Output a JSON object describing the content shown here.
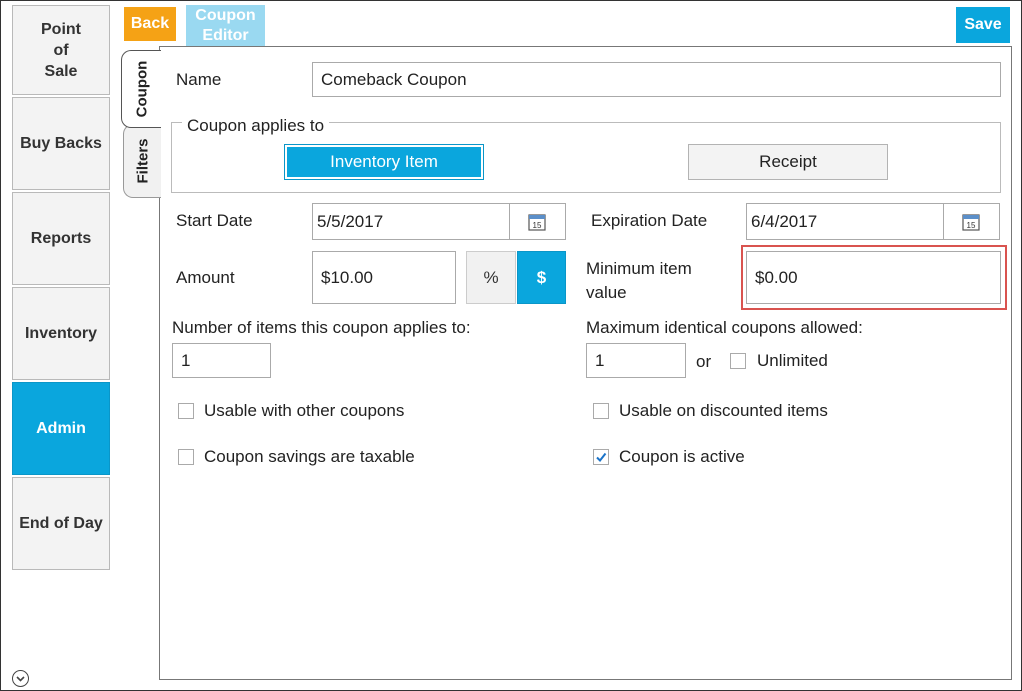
{
  "sidebar": {
    "items": [
      {
        "label": "Point\nof\nSale"
      },
      {
        "label": "Buy Backs"
      },
      {
        "label": "Reports"
      },
      {
        "label": "Inventory"
      },
      {
        "label": "Admin"
      },
      {
        "label": "End of Day"
      }
    ],
    "active": "Admin"
  },
  "toolbar": {
    "back_label": "Back",
    "title_label": "Coupon Editor",
    "save_label": "Save"
  },
  "tabs": [
    {
      "label": "Coupon",
      "active": true
    },
    {
      "label": "Filters",
      "active": false
    }
  ],
  "form": {
    "name_label": "Name",
    "name_value": "Comeback Coupon",
    "applies_to_legend": "Coupon applies to",
    "applies_options": [
      "Inventory Item",
      "Receipt"
    ],
    "applies_selected": "Inventory Item",
    "start_date_label": "Start Date",
    "start_date_value": "5/5/2017",
    "expiration_date_label": "Expiration Date",
    "expiration_date_value": "6/4/2017",
    "calendar_day": "15",
    "amount_label": "Amount",
    "amount_value": "$10.00",
    "amount_types": [
      "%",
      "$"
    ],
    "amount_type_selected": "$",
    "min_item_value_label": "Minimum item\nvalue",
    "min_item_value_value": "$0.00",
    "num_items_label": "Number of items this coupon applies to:",
    "num_items_value": "1",
    "max_identical_label": "Maximum identical coupons allowed:",
    "max_identical_value": "1",
    "or_label": "or",
    "unlimited_label": "Unlimited",
    "unlimited_checked": false,
    "usable_other_label": "Usable with other coupons",
    "usable_other_checked": false,
    "usable_discounted_label": "Usable on discounted items",
    "usable_discounted_checked": false,
    "taxable_label": "Coupon savings are taxable",
    "taxable_checked": false,
    "active_label": "Coupon is active",
    "active_checked": true
  },
  "colors": {
    "accent": "#0aa6dd",
    "back_button": "#f5a215",
    "title_button": "#9ad9f1",
    "highlight_border": "#d9534f"
  }
}
